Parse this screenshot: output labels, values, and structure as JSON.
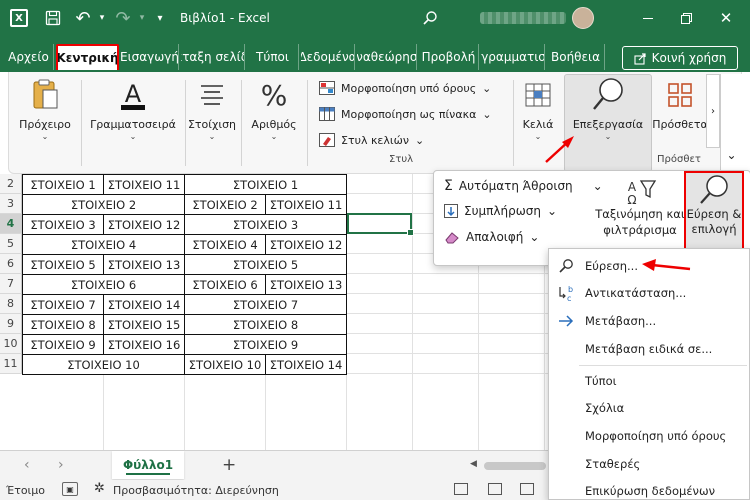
{
  "window": {
    "doc_title": "Βιβλίο1  -  Excel",
    "app_icon": "X"
  },
  "tabs": [
    {
      "label": "Αρχείο",
      "active": false
    },
    {
      "label": "Κεντρική",
      "active": true
    },
    {
      "label": "Εισαγωγή",
      "active": false
    },
    {
      "label": "Διάταξη σελίδας",
      "active": false
    },
    {
      "label": "Τύποι",
      "active": false
    },
    {
      "label": "Δεδομένα",
      "active": false
    },
    {
      "label": "Αναθεώρηση",
      "active": false
    },
    {
      "label": "Προβολή",
      "active": false
    },
    {
      "label": "Προγραμματιστής",
      "active": false
    },
    {
      "label": "Βοήθεια",
      "active": false
    }
  ],
  "share_label": "Κοινή χρήση",
  "ribbon": {
    "clipboard": "Πρόχειρο",
    "font": "Γραμματοσειρά",
    "alignment": "Στοίχιση",
    "number": "Αριθμός",
    "conditional_formatting": "Μορφοποίηση υπό όρους",
    "format_as_table": "Μορφοποίηση ως πίνακα",
    "cell_styles": "Στυλ κελιών",
    "styles_group": "Στυλ",
    "cells": "Κελιά",
    "editing": "Επεξεργασία",
    "insert": "Πρόσθετα",
    "insert_group": "Πρόσθετ"
  },
  "rows": [
    "2",
    "3",
    "4",
    "5",
    "6",
    "7",
    "8",
    "9",
    "10",
    "11"
  ],
  "selected_row": "4",
  "cells": [
    {
      "r": 0,
      "c": "A",
      "text": "ΣΤΟΙΧΕΙΟ 1"
    },
    {
      "r": 0,
      "c": "B",
      "text": "ΣΤΟΙΧΕΙΟ 11"
    },
    {
      "r": 0,
      "c": "CD",
      "text": "ΣΤΟΙΧΕΙΟ 1"
    },
    {
      "r": 1,
      "c": "AB",
      "text": "ΣΤΟΙΧΕΙΟ 2"
    },
    {
      "r": 1,
      "c": "C",
      "text": "ΣΤΟΙΧΕΙΟ 2"
    },
    {
      "r": 1,
      "c": "D",
      "text": "ΣΤΟΙΧΕΙΟ 11"
    },
    {
      "r": 2,
      "c": "A",
      "text": "ΣΤΟΙΧΕΙΟ 3"
    },
    {
      "r": 2,
      "c": "B",
      "text": "ΣΤΟΙΧΕΙΟ 12"
    },
    {
      "r": 2,
      "c": "CD",
      "text": "ΣΤΟΙΧΕΙΟ 3"
    },
    {
      "r": 3,
      "c": "AB",
      "text": "ΣΤΟΙΧΕΙΟ 4"
    },
    {
      "r": 3,
      "c": "C",
      "text": "ΣΤΟΙΧΕΙΟ 4"
    },
    {
      "r": 3,
      "c": "D",
      "text": "ΣΤΟΙΧΕΙΟ 12"
    },
    {
      "r": 4,
      "c": "A",
      "text": "ΣΤΟΙΧΕΙΟ 5"
    },
    {
      "r": 4,
      "c": "B",
      "text": "ΣΤΟΙΧΕΙΟ 13"
    },
    {
      "r": 4,
      "c": "CD",
      "text": "ΣΤΟΙΧΕΙΟ 5"
    },
    {
      "r": 5,
      "c": "AB",
      "text": "ΣΤΟΙΧΕΙΟ 6"
    },
    {
      "r": 5,
      "c": "C",
      "text": "ΣΤΟΙΧΕΙΟ 6"
    },
    {
      "r": 5,
      "c": "D",
      "text": "ΣΤΟΙΧΕΙΟ 13"
    },
    {
      "r": 6,
      "c": "A",
      "text": "ΣΤΟΙΧΕΙΟ 7"
    },
    {
      "r": 6,
      "c": "B",
      "text": "ΣΤΟΙΧΕΙΟ 14"
    },
    {
      "r": 6,
      "c": "CD",
      "text": "ΣΤΟΙΧΕΙΟ 7"
    },
    {
      "r": 7,
      "c": "A",
      "text": "ΣΤΟΙΧΕΙΟ 8"
    },
    {
      "r": 7,
      "c": "B",
      "text": "ΣΤΟΙΧΕΙΟ 15"
    },
    {
      "r": 7,
      "c": "CD",
      "text": "ΣΤΟΙΧΕΙΟ 8"
    },
    {
      "r": 8,
      "c": "A",
      "text": "ΣΤΟΙΧΕΙΟ 9"
    },
    {
      "r": 8,
      "c": "B",
      "text": "ΣΤΟΙΧΕΙΟ 16"
    },
    {
      "r": 8,
      "c": "CD",
      "text": "ΣΤΟΙΧΕΙΟ 9"
    },
    {
      "r": 9,
      "c": "AB",
      "text": "ΣΤΟΙΧΕΙΟ 10"
    },
    {
      "r": 9,
      "c": "C",
      "text": "ΣΤΟΙΧΕΙΟ 10"
    },
    {
      "r": 9,
      "c": "D",
      "text": "ΣΤΟΙΧΕΙΟ 14"
    }
  ],
  "editing_menu": {
    "autosum": "Αυτόματη Άθροιση",
    "fill": "Συμπλήρωση",
    "clear": "Απαλοιφή",
    "sort_line1": "Ταξινόμηση και",
    "sort_line2": "φιλτράρισμα",
    "find_line1": "Εύρεση &",
    "find_line2": "επιλογή"
  },
  "find_menu": {
    "find": "Εύρεση...",
    "replace": "Αντικατάσταση...",
    "goto": "Μετάβαση...",
    "goto_special": "Μετάβαση ειδικά σε...",
    "formulas": "Τύποι",
    "comments": "Σχόλια",
    "conditional": "Μορφοποίηση υπό όρους",
    "constants": "Σταθερές",
    "validation": "Επικύρωση δεδομένων"
  },
  "sheet_tab": "Φύλλο1",
  "status": {
    "ready": "Έτοιμο",
    "accessibility": "Προσβασιμότητα: Διερεύνηση"
  },
  "colors": {
    "excel_green": "#217346",
    "highlight_red": "#e00000"
  }
}
